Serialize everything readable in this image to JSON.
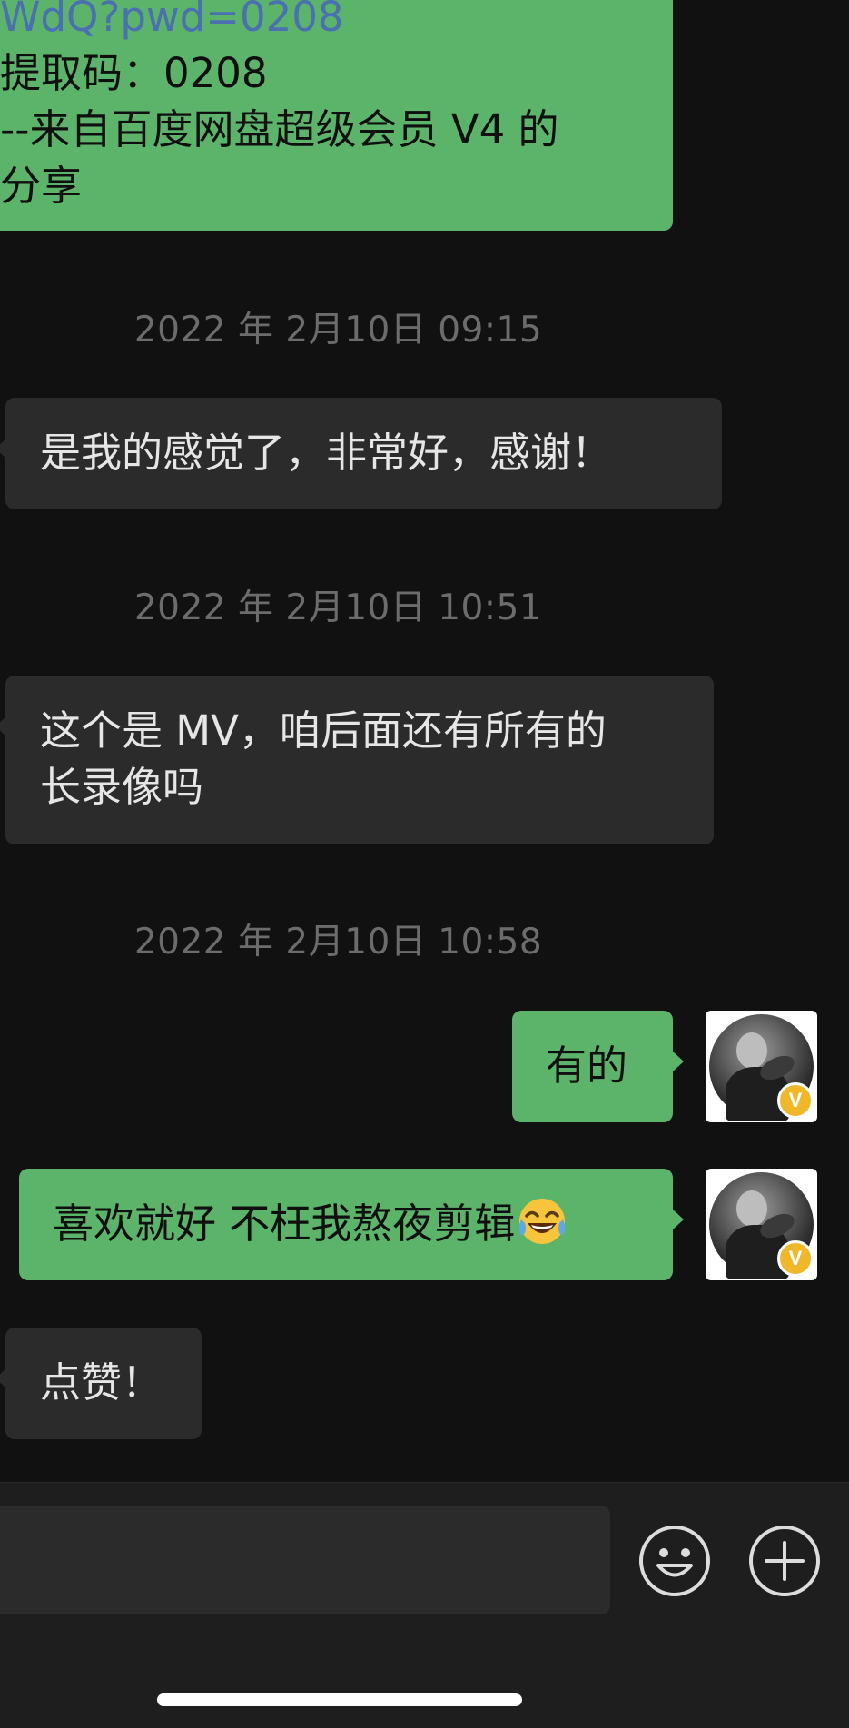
{
  "messages": {
    "share": {
      "link_tail": "WdQ?pwd=0208",
      "code_line": "提取码：0208",
      "source_line": "--来自百度网盘超级会员 V4 的",
      "share_word": "分享"
    },
    "ts1": "2022 年 2月10日 09:15",
    "msg1": "是我的感觉了，非常好，感谢！",
    "ts2": "2022 年 2月10日 10:51",
    "msg2_line1": "这个是 MV，咱后面还有所有的",
    "msg2_line2": "长录像吗",
    "ts3": "2022 年 2月10日 10:58",
    "msg3": "有的",
    "msg4": "喜欢就好 不枉我熬夜剪辑",
    "msg4_emoji": "tears-of-joy-emoji",
    "msg5": "点赞！"
  },
  "avatar": {
    "badge": "V",
    "badge_color": "#f0b829"
  },
  "input": {
    "value": "",
    "placeholder": ""
  },
  "icons": {
    "emoji_button": "smiley-face-icon",
    "more_button": "plus-circle-icon"
  },
  "colors": {
    "background": "#111111",
    "outgoing_bubble": "#5bb46a",
    "incoming_bubble": "#2b2b2b",
    "link": "#4a6fb2",
    "timestamp": "#6c6c6c"
  }
}
